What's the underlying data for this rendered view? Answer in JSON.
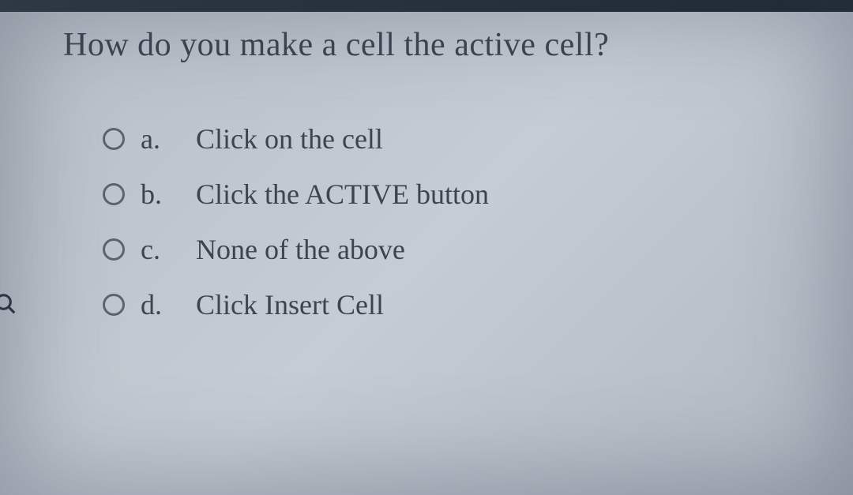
{
  "question": "How do you make a cell the active cell?",
  "options": [
    {
      "letter": "a.",
      "text": "Click on the cell"
    },
    {
      "letter": "b.",
      "text": "Click the ACTIVE button"
    },
    {
      "letter": "c.",
      "text": "None of the above"
    },
    {
      "letter": "d.",
      "text": "Click Insert Cell"
    }
  ]
}
